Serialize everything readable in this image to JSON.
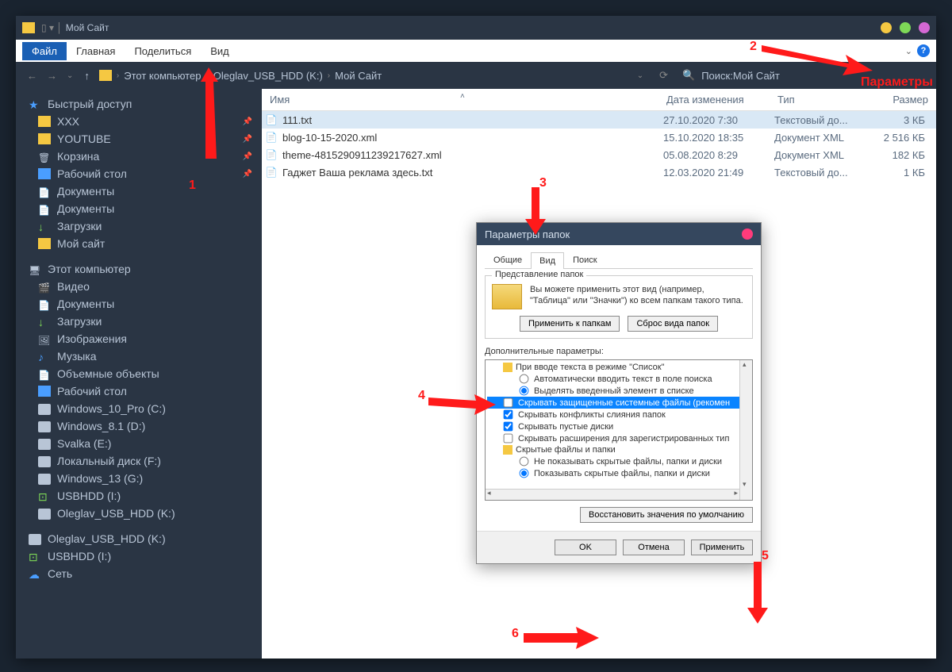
{
  "title": "Мой Сайт",
  "menu": {
    "file": "Файл",
    "home": "Главная",
    "share": "Поделиться",
    "view": "Вид"
  },
  "params_label": "Параметры",
  "breadcrumb": {
    "root": "Этот компьютер",
    "drive": "Oleglav_USB_HDD (K:)",
    "folder": "Мой Сайт"
  },
  "search_prefix": "Поиск: ",
  "search_value": "Мой Сайт",
  "columns": {
    "name": "Имя",
    "date": "Дата изменения",
    "type": "Тип",
    "size": "Размер"
  },
  "sidebar": {
    "quick": "Быстрый доступ",
    "quick_items": [
      {
        "label": "XXX",
        "icon": "ic-folder",
        "pin": true
      },
      {
        "label": "YOUTUBE",
        "icon": "ic-folder",
        "pin": true
      },
      {
        "label": "Корзина",
        "icon": "ic-trash",
        "pin": true
      },
      {
        "label": "Рабочий стол",
        "icon": "ic-desk",
        "pin": true
      },
      {
        "label": "Документы",
        "icon": "ic-doc",
        "pin": false
      },
      {
        "label": "Документы",
        "icon": "ic-doc",
        "pin": false
      },
      {
        "label": "Загрузки",
        "icon": "ic-dl",
        "pin": false
      },
      {
        "label": "Мой сайт",
        "icon": "ic-folder",
        "pin": false
      }
    ],
    "pc": "Этот компьютер",
    "pc_items": [
      {
        "label": "Видео",
        "icon": "ic-vid"
      },
      {
        "label": "Документы",
        "icon": "ic-doc"
      },
      {
        "label": "Загрузки",
        "icon": "ic-dl"
      },
      {
        "label": "Изображения",
        "icon": "ic-img"
      },
      {
        "label": "Музыка",
        "icon": "ic-music"
      },
      {
        "label": "Объемные объекты",
        "icon": "ic-doc"
      },
      {
        "label": "Рабочий стол",
        "icon": "ic-desk"
      },
      {
        "label": "Windows_10_Pro (C:)",
        "icon": "ic-dr"
      },
      {
        "label": "Windows_8.1 (D:)",
        "icon": "ic-dr"
      },
      {
        "label": "Svalka (E:)",
        "icon": "ic-dr"
      },
      {
        "label": "Локальный диск (F:)",
        "icon": "ic-dr"
      },
      {
        "label": "Windows_13 (G:)",
        "icon": "ic-dr"
      },
      {
        "label": "USBHDD (I:)",
        "icon": "ic-usb"
      },
      {
        "label": "Oleglav_USB_HDD (K:)",
        "icon": "ic-dr"
      }
    ],
    "extra": [
      {
        "label": "Oleglav_USB_HDD (K:)",
        "icon": "ic-dr"
      },
      {
        "label": "USBHDD (I:)",
        "icon": "ic-usb"
      },
      {
        "label": "Сеть",
        "icon": "ic-net"
      }
    ]
  },
  "files": [
    {
      "name": "111.txt",
      "date": "27.10.2020 7:30",
      "type": "Текстовый до...",
      "size": "3 КБ",
      "sel": true,
      "icon": "📄"
    },
    {
      "name": "blog-10-15-2020.xml",
      "date": "15.10.2020 18:35",
      "type": "Документ XML",
      "size": "2 516 КБ",
      "icon": "📄"
    },
    {
      "name": "theme-4815290911239217627.xml",
      "date": "05.08.2020 8:29",
      "type": "Документ XML",
      "size": "182 КБ",
      "icon": "📄"
    },
    {
      "name": "Гаджет Ваша реклама здесь.txt",
      "date": "12.03.2020 21:49",
      "type": "Текстовый до...",
      "size": "1 КБ",
      "icon": "📄"
    }
  ],
  "dialog": {
    "title": "Параметры папок",
    "tabs": {
      "general": "Общие",
      "view": "Вид",
      "search": "Поиск"
    },
    "group1": {
      "legend": "Представление папок",
      "text": "Вы можете применить этот вид (например, \"Таблица\" или \"Значки\") ко всем папкам такого типа.",
      "btn1": "Применить к папкам",
      "btn2": "Сброс вида папок"
    },
    "adv_label": "Дополнительные параметры:",
    "tree": {
      "n1": "При вводе текста в режиме \"Список\"",
      "n2": "Автоматически вводить текст в поле поиска",
      "n3": "Выделять введенный элемент в списке",
      "n4": "Скрывать защищенные системные файлы (рекомен",
      "n5": "Скрывать конфликты слияния папок",
      "n6": "Скрывать пустые диски",
      "n7": "Скрывать расширения для зарегистрированных тип",
      "n8": "Скрытые файлы и папки",
      "n9": "Не показывать скрытые файлы, папки и диски",
      "n10": "Показывать скрытые файлы, папки и диски"
    },
    "restore": "Восстановить значения по умолчанию",
    "ok": "OK",
    "cancel": "Отмена",
    "apply": "Применить"
  },
  "annotations": {
    "l1": "1",
    "l2": "2",
    "l3": "3",
    "l4": "4",
    "l5": "5",
    "l6": "6"
  }
}
